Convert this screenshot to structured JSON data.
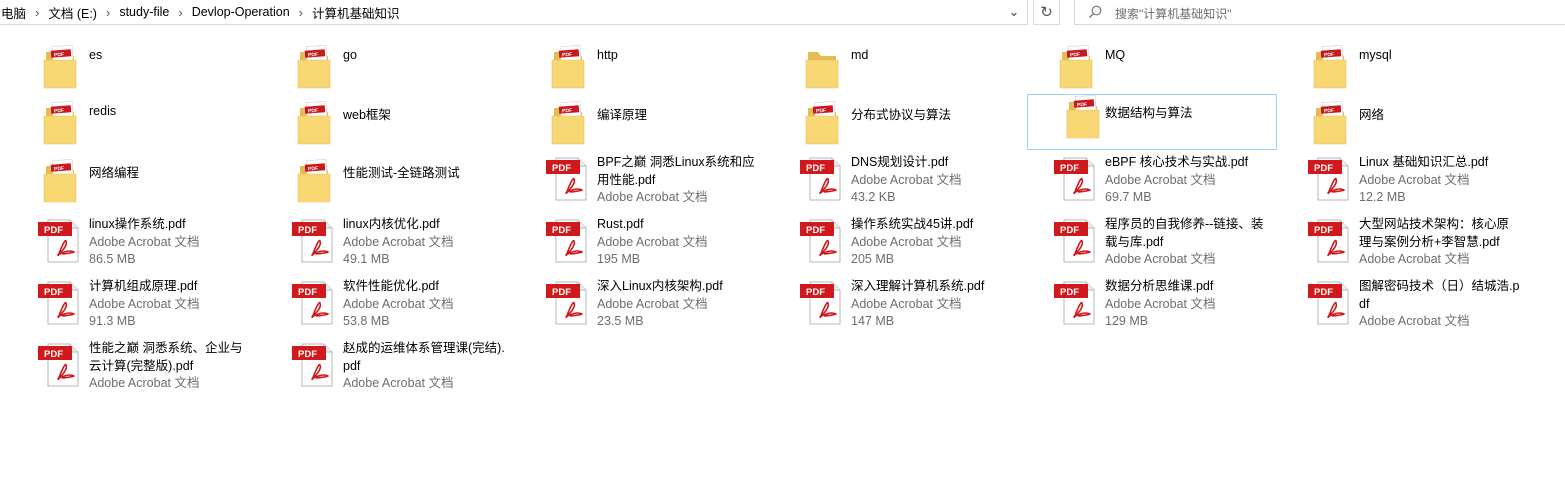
{
  "address_bar": {
    "crumbs": [
      "电脑",
      "文档 (E:)",
      "study-file",
      "Devlop-Operation",
      "计算机基础知识"
    ],
    "separator": "›",
    "dropdown_glyph": "⌄",
    "refresh_glyph": "↻"
  },
  "search": {
    "placeholder": "搜索\"计算机基础知识\""
  },
  "pdf_badge": "PDF",
  "folders": [
    {
      "name": "es",
      "variant": "pdf"
    },
    {
      "name": "go",
      "variant": "pdf"
    },
    {
      "name": "http",
      "variant": "pdf"
    },
    {
      "name": "md",
      "variant": "empty"
    },
    {
      "name": "MQ",
      "variant": "pdf"
    },
    {
      "name": "mysql",
      "variant": "pdf"
    },
    {
      "name": "redis",
      "variant": "pdf"
    },
    {
      "name": "web框架",
      "variant": "pdf"
    },
    {
      "name": "编译原理",
      "variant": "pdf"
    },
    {
      "name": "分布式协议与算法",
      "variant": "pdf"
    },
    {
      "name": "数据结构与算法",
      "variant": "pdf",
      "selected": true
    },
    {
      "name": "网络",
      "variant": "pdf"
    },
    {
      "name": "网络编程",
      "variant": "pdf"
    },
    {
      "name": "性能测试-全链路测试",
      "variant": "pdf"
    }
  ],
  "files": [
    {
      "name": "BPF之巅 洞悉Linux系统和应用性能.pdf",
      "type": "Adobe Acrobat 文档",
      "size": ""
    },
    {
      "name": "DNS规划设计.pdf",
      "type": "Adobe Acrobat 文档",
      "size": "43.2 KB"
    },
    {
      "name": "eBPF 核心技术与实战.pdf",
      "type": "Adobe Acrobat 文档",
      "size": "69.7 MB"
    },
    {
      "name": "Linux 基础知识汇总.pdf",
      "type": "Adobe Acrobat 文档",
      "size": "12.2 MB"
    },
    {
      "name": "linux操作系统.pdf",
      "type": "Adobe Acrobat 文档",
      "size": "86.5 MB"
    },
    {
      "name": "linux内核优化.pdf",
      "type": "Adobe Acrobat 文档",
      "size": "49.1 MB"
    },
    {
      "name": "Rust.pdf",
      "type": "Adobe Acrobat 文档",
      "size": "195 MB"
    },
    {
      "name": "操作系统实战45讲.pdf",
      "type": "Adobe Acrobat 文档",
      "size": "205 MB"
    },
    {
      "name": "程序员的自我修养--链接、装载与库.pdf",
      "type": "Adobe Acrobat 文档",
      "size": ""
    },
    {
      "name": "大型网站技术架构：核心原理与案例分析+李智慧.pdf",
      "type": "Adobe Acrobat 文档",
      "size": ""
    },
    {
      "name": "计算机组成原理.pdf",
      "type": "Adobe Acrobat 文档",
      "size": "91.3 MB"
    },
    {
      "name": "软件性能优化.pdf",
      "type": "Adobe Acrobat 文档",
      "size": "53.8 MB"
    },
    {
      "name": "深入Linux内核架构.pdf",
      "type": "Adobe Acrobat 文档",
      "size": "23.5 MB"
    },
    {
      "name": "深入理解计算机系统.pdf",
      "type": "Adobe Acrobat 文档",
      "size": "147 MB"
    },
    {
      "name": "数据分析思维课.pdf",
      "type": "Adobe Acrobat 文档",
      "size": "129 MB"
    },
    {
      "name": "图解密码技术（日）结城浩.pdf",
      "type": "Adobe Acrobat 文档",
      "size": ""
    },
    {
      "name": "性能之巅  洞悉系统、企业与云计算(完整版).pdf",
      "type": "Adobe Acrobat 文档",
      "size": ""
    },
    {
      "name": "赵成的运维体系管理课(完结).pdf",
      "type": "Adobe Acrobat 文档",
      "size": ""
    }
  ]
}
